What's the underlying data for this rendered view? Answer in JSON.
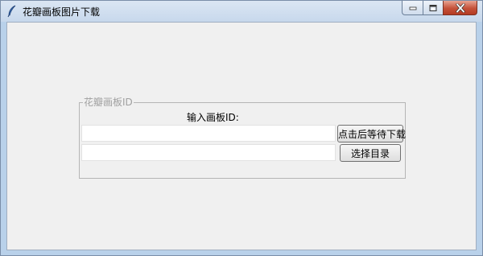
{
  "window": {
    "title": "花瓣画板图片下载",
    "close_color": "#c45139"
  },
  "group": {
    "label": "花瓣画板ID"
  },
  "form": {
    "prompt": "输入画板ID:",
    "board_id_value": "",
    "directory_value": "",
    "download_button": "点击后等待下载",
    "choose_dir_button": "选择目录"
  },
  "icons": {
    "app": "feather-icon",
    "minimize": "minimize-icon",
    "maximize": "maximize-icon",
    "close": "close-icon"
  }
}
